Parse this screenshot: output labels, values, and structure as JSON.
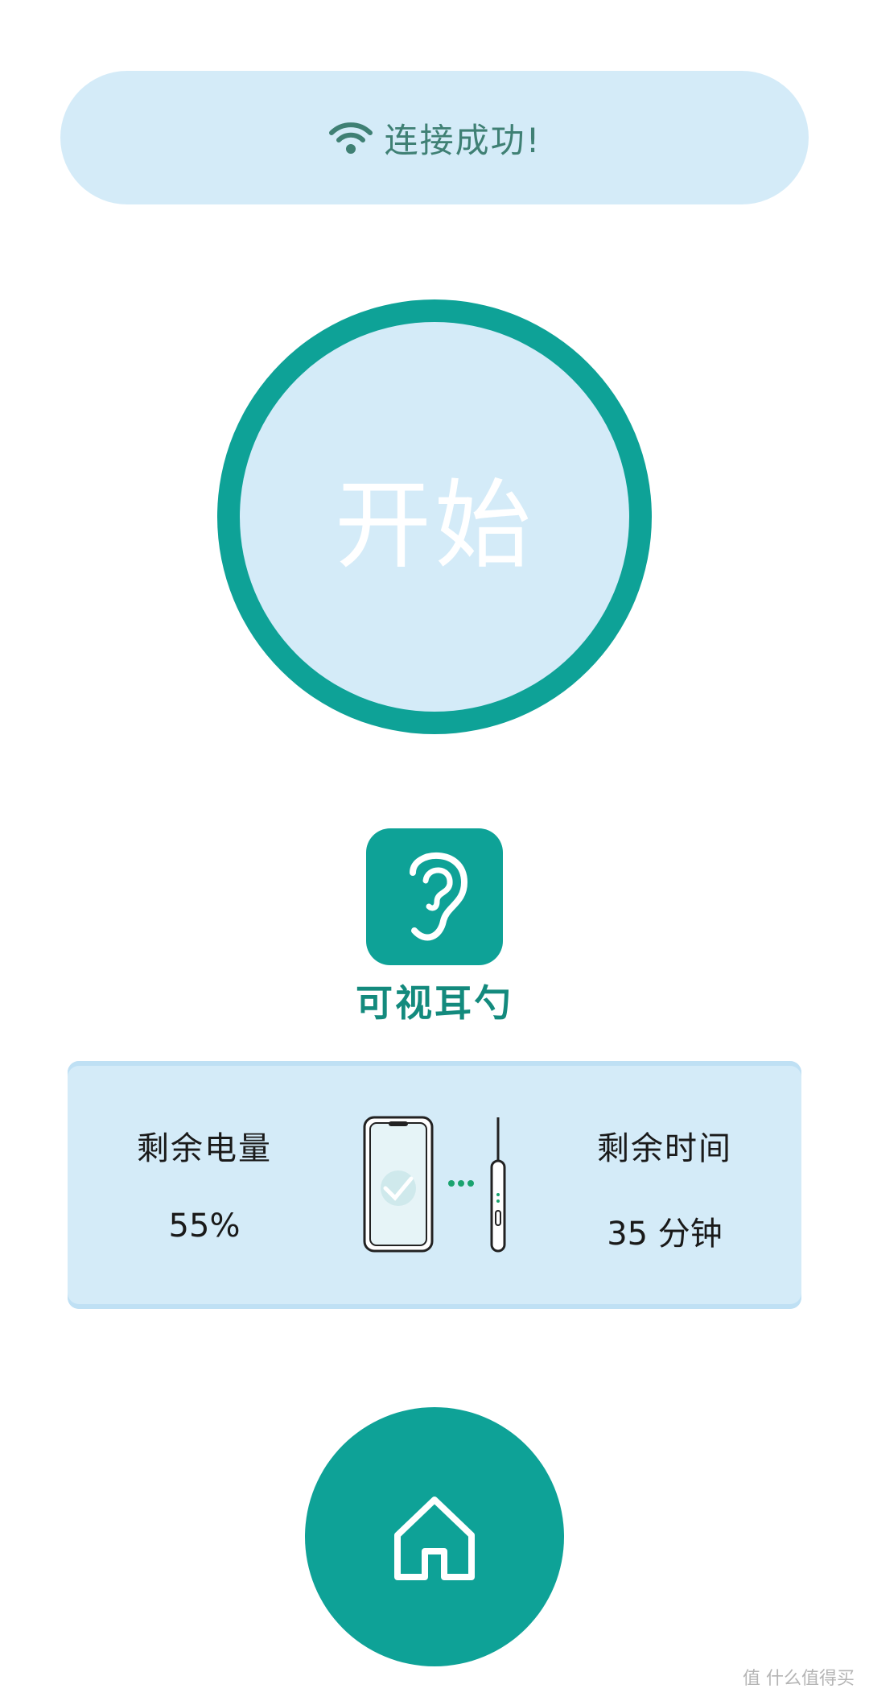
{
  "status": {
    "icon": "wifi-icon",
    "text": "连接成功!"
  },
  "start": {
    "label": "开始"
  },
  "device": {
    "icon": "ear-icon",
    "name": "可视耳勺"
  },
  "info": {
    "battery_label": "剩余电量",
    "battery_value": "55%",
    "time_label": "剩余时间",
    "time_value": "35 分钟",
    "graphic_icon": "phone-earpick-connection-icon"
  },
  "home": {
    "icon": "home-icon"
  },
  "watermark": "值 什么值得买",
  "colors": {
    "accent": "#0ea297",
    "panel": "#d4ebf8",
    "status_text": "#3f8074",
    "device_name": "#138a7d"
  }
}
